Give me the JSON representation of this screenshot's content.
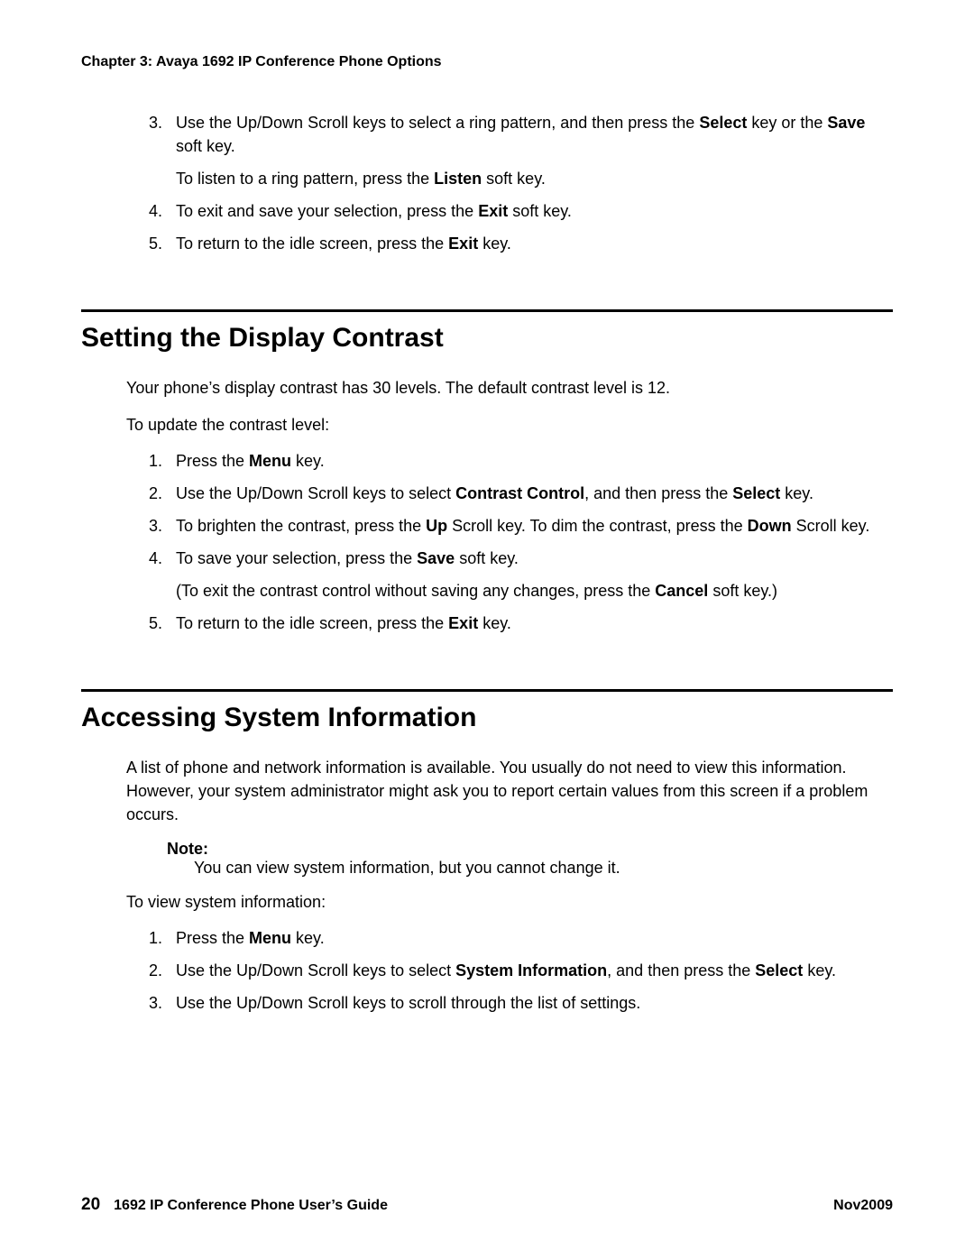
{
  "header": {
    "chapter": "Chapter 3: Avaya 1692 IP Conference Phone Options"
  },
  "topList": {
    "item3": {
      "num": "3.",
      "text_a": "Use the Up/Down Scroll keys to select a ring pattern, and then press the ",
      "bold_a": "Select",
      "text_b": " key or the ",
      "bold_b": "Save",
      "text_c": " soft key.",
      "sub_a": "To listen to a ring pattern, press the ",
      "sub_bold": "Listen",
      "sub_b": " soft key."
    },
    "item4": {
      "num": "4.",
      "text_a": "To exit and save your selection, press the ",
      "bold_a": "Exit",
      "text_b": " soft key."
    },
    "item5": {
      "num": "5.",
      "text_a": "To return to the idle screen, press the ",
      "bold_a": "Exit",
      "text_b": " key."
    }
  },
  "section1": {
    "heading": "Setting the Display Contrast",
    "para1": "Your phone’s display contrast has 30 levels. The default contrast level is 12.",
    "para2": "To update the contrast level:",
    "list": {
      "item1": {
        "num": "1.",
        "text_a": "Press the ",
        "bold_a": "Menu",
        "text_b": " key."
      },
      "item2": {
        "num": "2.",
        "text_a": "Use the Up/Down Scroll keys to select ",
        "bold_a": "Contrast Control",
        "text_b": ", and then press the ",
        "bold_b": "Select",
        "text_c": " key."
      },
      "item3": {
        "num": "3.",
        "text_a": "To brighten the contrast, press the ",
        "bold_a": "Up",
        "text_b": " Scroll key. To dim the contrast, press the ",
        "bold_b": "Down",
        "text_c": " Scroll key."
      },
      "item4": {
        "num": "4.",
        "text_a": "To save your selection, press the ",
        "bold_a": "Save",
        "text_b": " soft key.",
        "sub_a": "(To exit the contrast control without saving any changes, press the ",
        "sub_bold": "Cancel",
        "sub_b": " soft key.)"
      },
      "item5": {
        "num": "5.",
        "text_a": "To return to the idle screen, press the ",
        "bold_a": "Exit",
        "text_b": " key."
      }
    }
  },
  "section2": {
    "heading": "Accessing System Information",
    "para1": "A list of phone and network information is available. You usually do not need to view this information. However, your system administrator might ask you to report certain values from this screen if a problem occurs.",
    "note": {
      "label": "Note:",
      "text": "You can view system information, but you cannot change it."
    },
    "para2": "To view system information:",
    "list": {
      "item1": {
        "num": "1.",
        "text_a": "Press the ",
        "bold_a": "Menu",
        "text_b": " key."
      },
      "item2": {
        "num": "2.",
        "text_a": "Use the Up/Down Scroll keys to select ",
        "bold_a": "System Information",
        "text_b": ", and then press the ",
        "bold_b": "Select",
        "text_c": " key."
      },
      "item3": {
        "num": "3.",
        "text_a": "Use the Up/Down Scroll keys to scroll through the list of settings."
      }
    }
  },
  "footer": {
    "pageNum": "20",
    "title": "1692 IP Conference Phone User’s Guide",
    "date": "Nov2009"
  }
}
